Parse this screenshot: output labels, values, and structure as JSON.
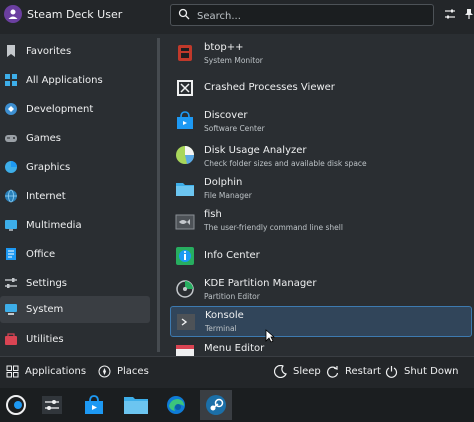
{
  "header": {
    "username": "Steam Deck User",
    "search_placeholder": "Search..."
  },
  "sidebar": {
    "items": [
      {
        "label": "Favorites",
        "icon": "bookmark-icon"
      },
      {
        "label": "All Applications",
        "icon": "grid-icon"
      },
      {
        "label": "Development",
        "icon": "development-icon"
      },
      {
        "label": "Games",
        "icon": "gamepad-icon"
      },
      {
        "label": "Graphics",
        "icon": "graphics-icon"
      },
      {
        "label": "Internet",
        "icon": "globe-icon"
      },
      {
        "label": "Multimedia",
        "icon": "multimedia-icon"
      },
      {
        "label": "Office",
        "icon": "office-icon"
      },
      {
        "label": "Settings",
        "icon": "settings-icon"
      },
      {
        "label": "System",
        "icon": "system-icon",
        "selected": true
      },
      {
        "label": "Utilities",
        "icon": "utilities-icon"
      }
    ]
  },
  "apps": [
    {
      "name": "btop++",
      "desc": "System Monitor",
      "icon": "btop-icon"
    },
    {
      "name": "Crashed Processes Viewer",
      "desc": "",
      "icon": "crash-viewer-icon"
    },
    {
      "name": "Discover",
      "desc": "Software Center",
      "icon": "discover-icon"
    },
    {
      "name": "Disk Usage Analyzer",
      "desc": "Check folder sizes and available disk space",
      "icon": "disk-usage-icon"
    },
    {
      "name": "Dolphin",
      "desc": "File Manager",
      "icon": "folder-icon"
    },
    {
      "name": "fish",
      "desc": "The user-friendly command line shell",
      "icon": "fish-terminal-icon"
    },
    {
      "name": "Info Center",
      "desc": "",
      "icon": "info-center-icon"
    },
    {
      "name": "KDE Partition Manager",
      "desc": "Partition Editor",
      "icon": "partition-manager-icon"
    },
    {
      "name": "Konsole",
      "desc": "Terminal",
      "icon": "konsole-icon",
      "hover": true
    },
    {
      "name": "Menu Editor",
      "desc": "",
      "icon": "menu-editor-icon"
    }
  ],
  "footer": {
    "applications": "Applications",
    "places": "Places",
    "sleep": "Sleep",
    "restart": "Restart",
    "shutdown": "Shut Down"
  },
  "taskbar": {
    "items": [
      "application-launcher-icon",
      "system-settings-icon",
      "discover-icon",
      "dolphin-icon",
      "edge-browser-icon",
      "steam-icon"
    ]
  },
  "colors": {
    "background": "#2a2e32",
    "accent": "#3d7ab0",
    "selection": "#3a3e43"
  }
}
